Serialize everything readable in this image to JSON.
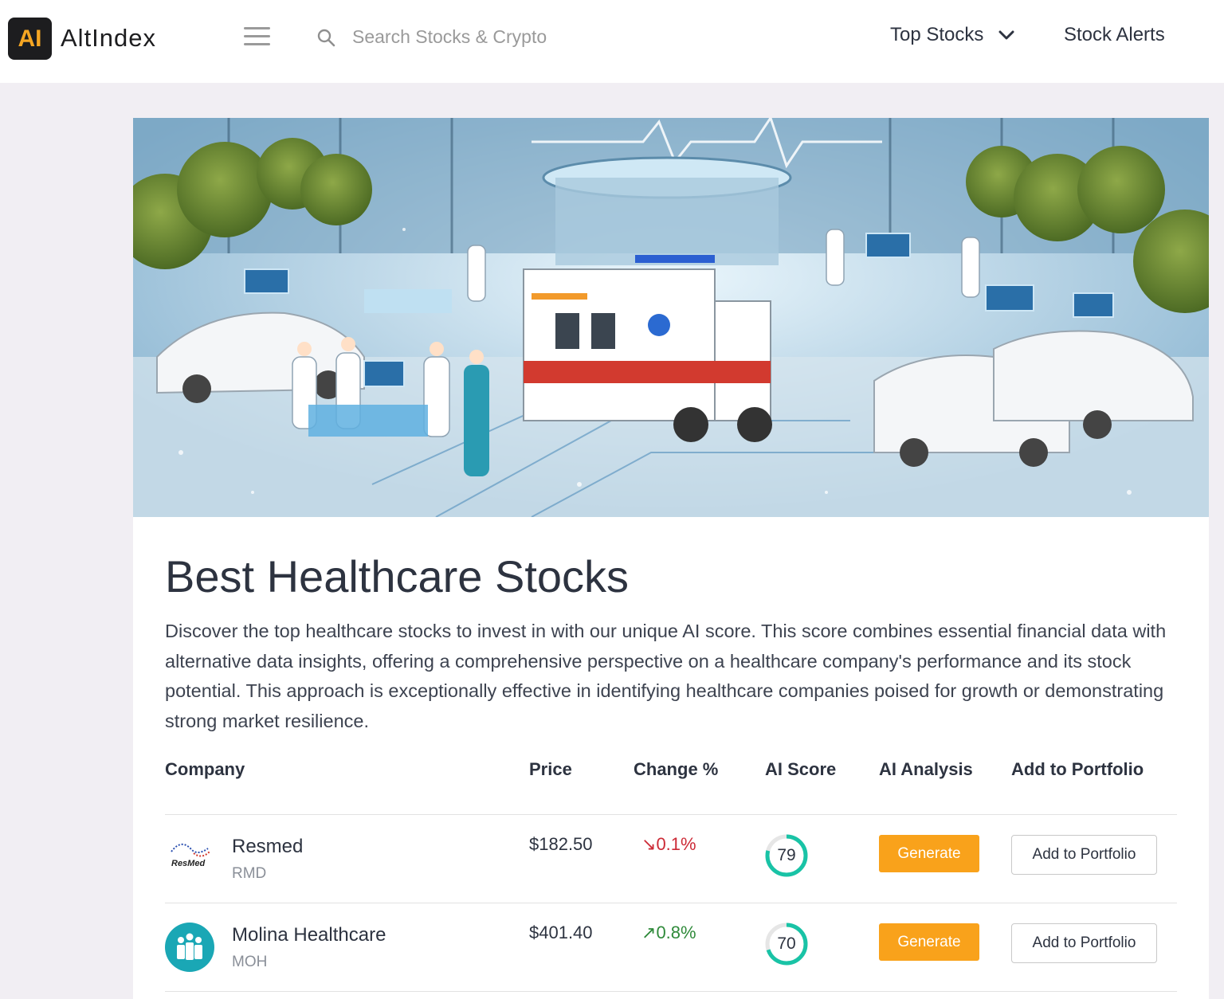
{
  "header": {
    "logo_mark": "AI",
    "logo_text": "AltIndex",
    "search_placeholder": "Search Stocks & Crypto",
    "nav": {
      "top_stocks": "Top Stocks",
      "stock_alerts": "Stock Alerts"
    }
  },
  "hero": {
    "icon": "hospital-scene-illustration"
  },
  "main": {
    "title": "Best Healthcare Stocks",
    "description": "Discover the top healthcare stocks to invest in with our unique AI score. This score combines essential financial data with alternative data insights, offering a comprehensive perspective on a healthcare company's performance and its stock potential. This approach is exceptionally effective in identifying healthcare companies poised for growth or demonstrating strong market resilience."
  },
  "table": {
    "columns": [
      "Company",
      "Price",
      "Change %",
      "AI Score",
      "AI Analysis",
      "Add to Portfolio"
    ],
    "rows": [
      {
        "name": "Resmed",
        "ticker": "RMD",
        "logo_text": "ResMed",
        "price": "$182.50",
        "change": "0.1%",
        "change_direction": "down",
        "change_arrow": "↘",
        "ai_score": "79",
        "ai_score_value": 79,
        "generate_label": "Generate",
        "add_label": "Add to Portfolio"
      },
      {
        "name": "Molina Healthcare",
        "ticker": "MOH",
        "price": "$401.40",
        "change": "0.8%",
        "change_direction": "up",
        "change_arrow": "↗",
        "ai_score": "70",
        "ai_score_value": 70,
        "generate_label": "Generate",
        "add_label": "Add to Portfolio"
      }
    ]
  },
  "colors": {
    "accent_orange": "#f9a21b",
    "negative": "#cc2a36",
    "positive": "#2f8a3a",
    "score_ring": "#19c3a6",
    "molina_teal": "#1aa7b5"
  }
}
